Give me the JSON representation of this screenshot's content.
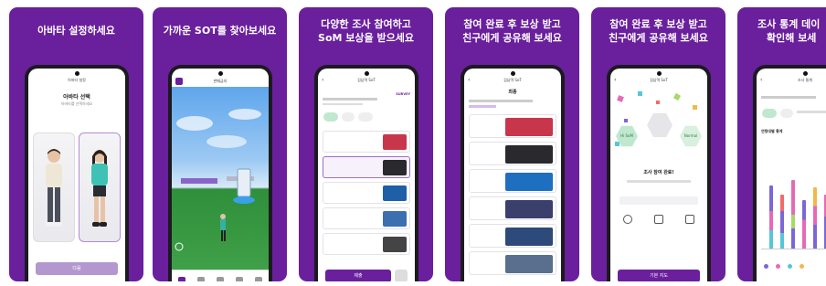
{
  "cards": [
    {
      "caption": [
        "아바타 설정하세요"
      ],
      "screen": {
        "title": "아바타 설정",
        "heading": "아바타 선택",
        "subtext": "아바타를 선택하세요",
        "button": "다음"
      }
    },
    {
      "caption": [
        "가까운 SOT를 찾아보세요"
      ],
      "screen": {
        "title": "판매금지"
      }
    },
    {
      "caption": [
        "다양한 조사 참여하고",
        "SoM 보상을 받으세요"
      ],
      "screen": {
        "title": "검남역 SoT",
        "brand": "SURVEY",
        "button": "제출"
      }
    },
    {
      "caption": [
        "참여 완료 후 보상 받고",
        "친구에게 공유해 보세요"
      ],
      "screen": {
        "title": "검남역 SoT",
        "heading": "최종"
      }
    },
    {
      "caption": [
        "참여 완료 후 보상 받고",
        "친구에게 공유해 보세요"
      ],
      "screen": {
        "title": "검남역 SoT",
        "hex_left": "Hi SoM",
        "hex_right": "Normal",
        "complete": "조사 참여 완료!",
        "button": "기본 지도"
      }
    },
    {
      "caption": [
        "조사 통계 데이",
        "확인해 보세"
      ],
      "screen": {
        "title": "조사 통계",
        "chart_title": "연령대별 통계"
      }
    }
  ],
  "colors": {
    "card_bg": "#6a1f9c",
    "accent": "#6a1f9c"
  }
}
